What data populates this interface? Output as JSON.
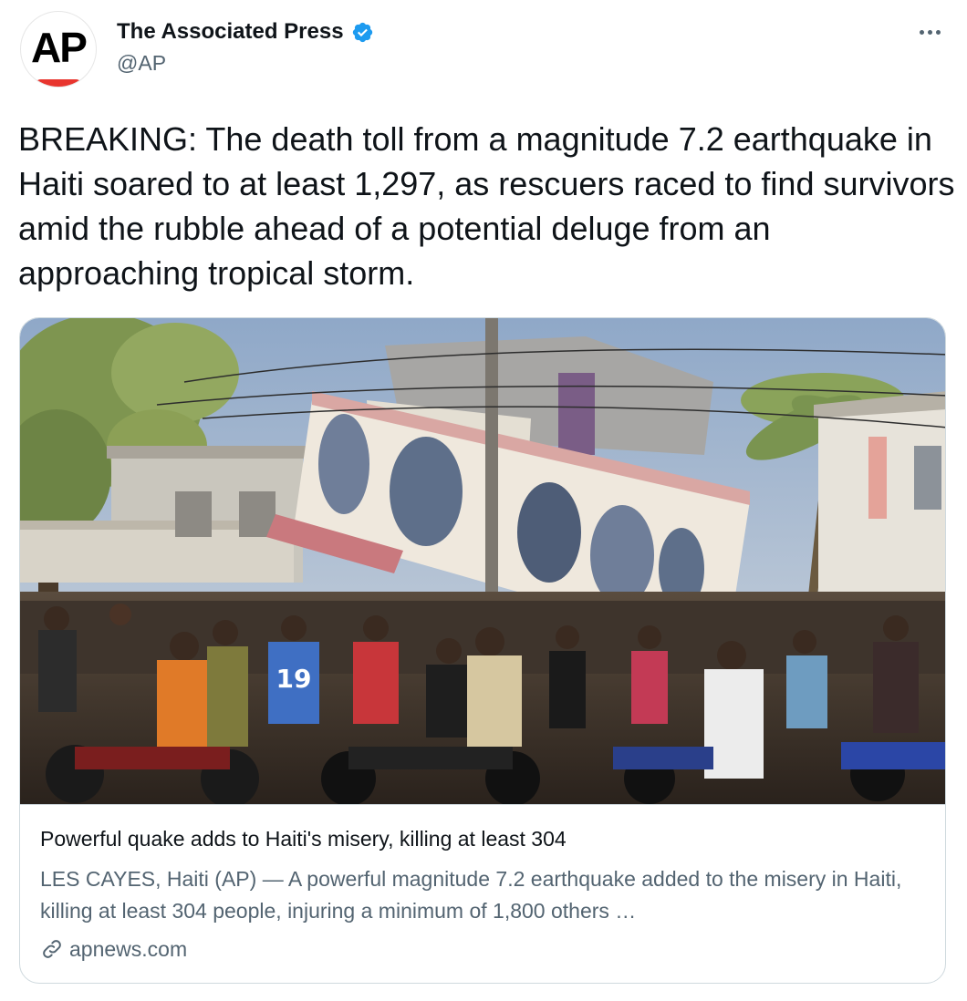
{
  "author": {
    "display_name": "The Associated Press",
    "handle": "@AP",
    "verified": true,
    "avatar_logo": "AP",
    "avatar_colors": {
      "text": "#000000",
      "bar": "#e8352e"
    }
  },
  "menu_icon": "more-horizontal-icon",
  "tweet": {
    "text": "BREAKING: The death toll from a magnitude 7.2 earthquake in Haiti soared to at least 1,297, as rescuers raced to find survivors amid the rubble ahead of a potential deluge from an approaching tropical storm."
  },
  "card": {
    "title": "Powerful quake adds to Haiti's misery, killing at least 304",
    "description": "LES CAYES, Haiti (AP) — A powerful magnitude 7.2 earthquake added to the misery in Haiti, killing at least 304 people, injuring a minimum of 1,800 others …",
    "domain": "apnews.com",
    "domain_icon": "link-icon",
    "image": {
      "description": "collapsed-building-crowd-photo",
      "shirt_number": "19"
    }
  },
  "colors": {
    "text_primary": "#0f1419",
    "text_secondary": "#536471",
    "border": "#cfd9de",
    "verified_badge": "#1d9bf0"
  }
}
